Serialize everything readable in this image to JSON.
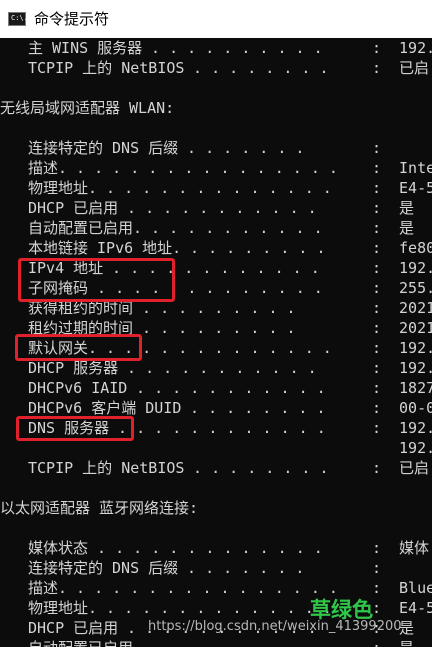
{
  "window": {
    "title": "命令提示符",
    "icon": "cmd-icon",
    "icon_text": "C:\\."
  },
  "console_lines": [
    {
      "indent": "   ",
      "label": "主 WINS 服务器",
      "dots": " . . . . . . . . . .",
      "colon": ":",
      "value": " 192."
    },
    {
      "indent": "   ",
      "label": "TCPIP 上的 NetBIOS",
      "dots": " . . . . . . . .",
      "colon": ":",
      "value": " 已启"
    },
    {
      "indent": "",
      "label": "",
      "dots": "",
      "colon": "",
      "value": ""
    },
    {
      "indent": "",
      "label": "无线局域网适配器 WLAN:",
      "dots": "",
      "colon": "",
      "value": ""
    },
    {
      "indent": "",
      "label": "",
      "dots": "",
      "colon": "",
      "value": ""
    },
    {
      "indent": "   ",
      "label": "连接特定的 DNS 后缀",
      "dots": " . . . . . . .",
      "colon": ":",
      "value": ""
    },
    {
      "indent": "   ",
      "label": "描述.",
      "dots": " . . . . . . . . . . . . . . .",
      "colon": ":",
      "value": " Inte"
    },
    {
      "indent": "   ",
      "label": "物理地址.",
      "dots": " . . . . . . . . . . . . .",
      "colon": ":",
      "value": " E4-5"
    },
    {
      "indent": "   ",
      "label": "DHCP 已启用",
      "dots": " . . . . . . . . . . .",
      "colon": ":",
      "value": " 是"
    },
    {
      "indent": "   ",
      "label": "自动配置已启用.",
      "dots": " . . . . . . . . . .",
      "colon": ":",
      "value": " 是"
    },
    {
      "indent": "   ",
      "label": "本地链接 IPv6 地址.",
      "dots": " . . . . . . . .",
      "colon": ":",
      "value": " fe80"
    },
    {
      "indent": "   ",
      "label": "IPv4 地址",
      "dots": " . . . . . . . . . . . .",
      "colon": ":",
      "value": " 192."
    },
    {
      "indent": "   ",
      "label": "子网掩码",
      "dots": " . . . . . . . . . . . . .",
      "colon": ":",
      "value": " 255."
    },
    {
      "indent": "   ",
      "label": "获得租约的时间",
      "dots": " . . . . . . . . .",
      "colon": ":",
      "value": " 2021"
    },
    {
      "indent": "   ",
      "label": "租约过期的时间",
      "dots": " . . . . . . . . .",
      "colon": ":",
      "value": " 2021"
    },
    {
      "indent": "   ",
      "label": "默认网关.",
      "dots": " . . . . . . . . . . . . .",
      "colon": ":",
      "value": " 192."
    },
    {
      "indent": "   ",
      "label": "DHCP 服务器",
      "dots": " . . . . . . . . . . .",
      "colon": ":",
      "value": " 192."
    },
    {
      "indent": "   ",
      "label": "DHCPv6 IAID",
      "dots": " . . . . . . . . . . .",
      "colon": ":",
      "value": " 1827"
    },
    {
      "indent": "   ",
      "label": "DHCPv6 客户端 DUID",
      "dots": " . . . . . . . .",
      "colon": ":",
      "value": " 00-0"
    },
    {
      "indent": "   ",
      "label": "DNS 服务器",
      "dots": " . . . . . . . . . . . .",
      "colon": ":",
      "value": " 192."
    },
    {
      "indent": "   ",
      "label": "",
      "dots": "",
      "colon": "",
      "value": " 192."
    },
    {
      "indent": "   ",
      "label": "TCPIP 上的 NetBIOS",
      "dots": " . . . . . . . .",
      "colon": ":",
      "value": " 已启"
    },
    {
      "indent": "",
      "label": "",
      "dots": "",
      "colon": "",
      "value": ""
    },
    {
      "indent": "",
      "label": "以太网适配器 蓝牙网络连接:",
      "dots": "",
      "colon": "",
      "value": ""
    },
    {
      "indent": "",
      "label": "",
      "dots": "",
      "colon": "",
      "value": ""
    },
    {
      "indent": "   ",
      "label": "媒体状态",
      "dots": " . . . . . . . . . . . . .",
      "colon": ":",
      "value": " 媒体"
    },
    {
      "indent": "   ",
      "label": "连接特定的 DNS 后缀",
      "dots": " . . . . . . .",
      "colon": ":",
      "value": ""
    },
    {
      "indent": "   ",
      "label": "描述.",
      "dots": " . . . . . . . . . . . . . . .",
      "colon": ":",
      "value": " Blue"
    },
    {
      "indent": "   ",
      "label": "物理地址.",
      "dots": " . . . . . . . . . . . . .",
      "colon": ":",
      "value": " E4-5"
    },
    {
      "indent": "   ",
      "label": "DHCP 已启用",
      "dots": " . . . . . . . . . . .",
      "colon": ":",
      "value": " 是"
    },
    {
      "indent": "   ",
      "label": "自动配置已启用.",
      "dots": " . . . . . . . . . .",
      "colon": ":",
      "value": " 是"
    }
  ],
  "highlights": [
    {
      "name": "highlight-ipv4-subnet"
    },
    {
      "name": "highlight-default-gateway"
    },
    {
      "name": "highlight-dns-server"
    }
  ],
  "watermark": {
    "url": "https://blog.csdn.net/weixin_41399200",
    "logo": "草绿色"
  },
  "colors": {
    "console_bg": "#0c0c0c",
    "console_text": "#d4d4d4",
    "highlight": "#e0202a",
    "logo": "#2fc64a"
  }
}
